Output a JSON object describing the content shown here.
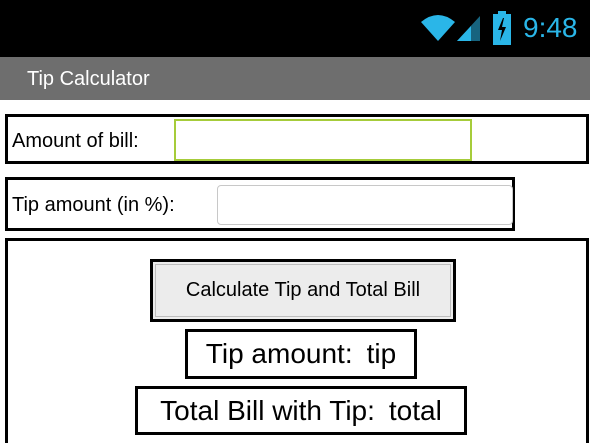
{
  "status_bar": {
    "time": "9:48",
    "icons": [
      "wifi-icon",
      "signal-icon",
      "battery-icon"
    ],
    "accent_color": "#2ab6e8"
  },
  "app": {
    "title": "Tip Calculator",
    "action_bar_color": "#6e6e6e"
  },
  "form": {
    "bill_label": "Amount of bill:",
    "bill_value": "",
    "tip_label": "Tip amount (in %):",
    "tip_value": ""
  },
  "actions": {
    "calculate_label": "Calculate Tip and Total Bill"
  },
  "results": {
    "tip_label": "Tip amount:",
    "tip_value": "tip",
    "total_label": "Total Bill with Tip:",
    "total_value": "total"
  }
}
